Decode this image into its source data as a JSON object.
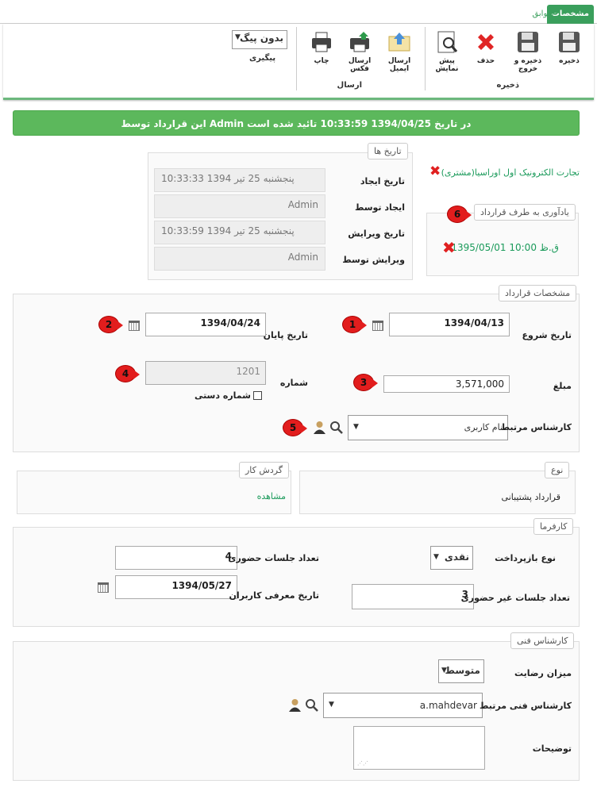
{
  "tabs": {
    "active": "مشخصات",
    "other": "سوابق"
  },
  "toolbar": {
    "save": "ذخیره",
    "save_exit": "ذخیره و خروج",
    "delete": "حذف",
    "preview": "پیش نمایش",
    "save_group": "ذخیره",
    "send_email": "ارسال ایمیل",
    "send_fax": "ارسال فکس",
    "print": "چاپ",
    "send_group": "ارسال",
    "followup_value": "بدون پیگ",
    "followup_label": "پیگیری"
  },
  "banner": "این قرارداد توسط Admin در تاریخ 1394/04/25 10:33:59 تائید شده است",
  "customer_link": "تجارت الکترونیک اول اوراسیا(مشتری)",
  "dates": {
    "legend": "تاریخ ها",
    "created_label": "تاریخ ایجاد",
    "created_value": "پنجشنبه 25 تیر 1394 10:33:33",
    "created_by_label": "ایجاد توسط",
    "created_by_value": "Admin",
    "edited_label": "تاریخ ویرایش",
    "edited_value": "پنجشنبه 25 تیر 1394 10:33:59",
    "edited_by_label": "ویرایش توسط",
    "edited_by_value": "Admin"
  },
  "reminder": {
    "legend": "یادآوری به طرف قرارداد",
    "item": "1395/05/01 10:00 ق.ظ"
  },
  "contract": {
    "legend": "مشخصات قرارداد",
    "start_label": "تاریخ شروع",
    "start_value": "1394/04/13",
    "end_label": "تاریخ پایان",
    "end_value": "1394/04/24",
    "amount_label": "مبلغ",
    "amount_value": "3,571,000",
    "number_label": "شماره",
    "number_value": "1201",
    "manual_label": "شماره دستی",
    "expert_label": "کارشناس مرتبط",
    "expert_value": "نام کاربری"
  },
  "markers": [
    "1",
    "2",
    "3",
    "4",
    "5",
    "6"
  ],
  "type": {
    "legend": "نوع",
    "value": "قرارداد پشتیبانی"
  },
  "workflow": {
    "legend": "گردش کار",
    "link": "مشاهده"
  },
  "employer": {
    "legend": "کارفرما",
    "repay_label": "نوع بازپرداخت",
    "repay_value": "نقدی",
    "sessions_label": "تعداد جلسات حضوری",
    "sessions_value": "4",
    "remote_label": "تعداد جلسات غیر حضوری",
    "remote_value": "3",
    "intro_label": "تاریخ معرفی کاربران",
    "intro_value": "1394/05/27"
  },
  "tech": {
    "legend": "کارشناس فنی",
    "satisfaction_label": "میزان رضایت",
    "satisfaction_value": "متوسط",
    "expert_label": "کارشناس فنی مرتبط",
    "expert_value": "a.mahdevar",
    "notes_label": "توضیحات"
  },
  "colors": {
    "accent": "#3a9f5c",
    "banner": "#5cb85c",
    "marker": "#e21d1d"
  }
}
